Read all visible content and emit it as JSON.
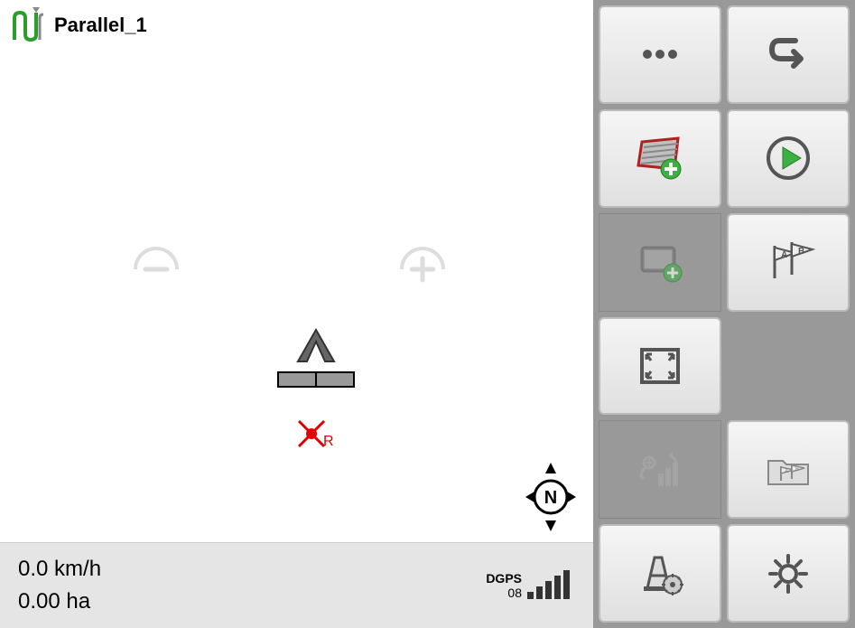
{
  "header": {
    "title": "Parallel_1"
  },
  "ref_point": {
    "label": "R"
  },
  "compass": {
    "label": "N"
  },
  "status": {
    "speed": "0.0 km/h",
    "area": "0.00 ha",
    "gps_mode": "DGPS",
    "gps_count": "08"
  },
  "buttons": {
    "more": "more-options",
    "back": "back",
    "add_field": "add-field",
    "play": "play",
    "add_boundary": "add-boundary",
    "ab_flags": "ab-flags",
    "fullscreen": "fullscreen",
    "replay_chart": "replay-chart",
    "flag_folder": "flag-folder",
    "cone_settings": "obstacle-settings",
    "settings": "settings"
  }
}
